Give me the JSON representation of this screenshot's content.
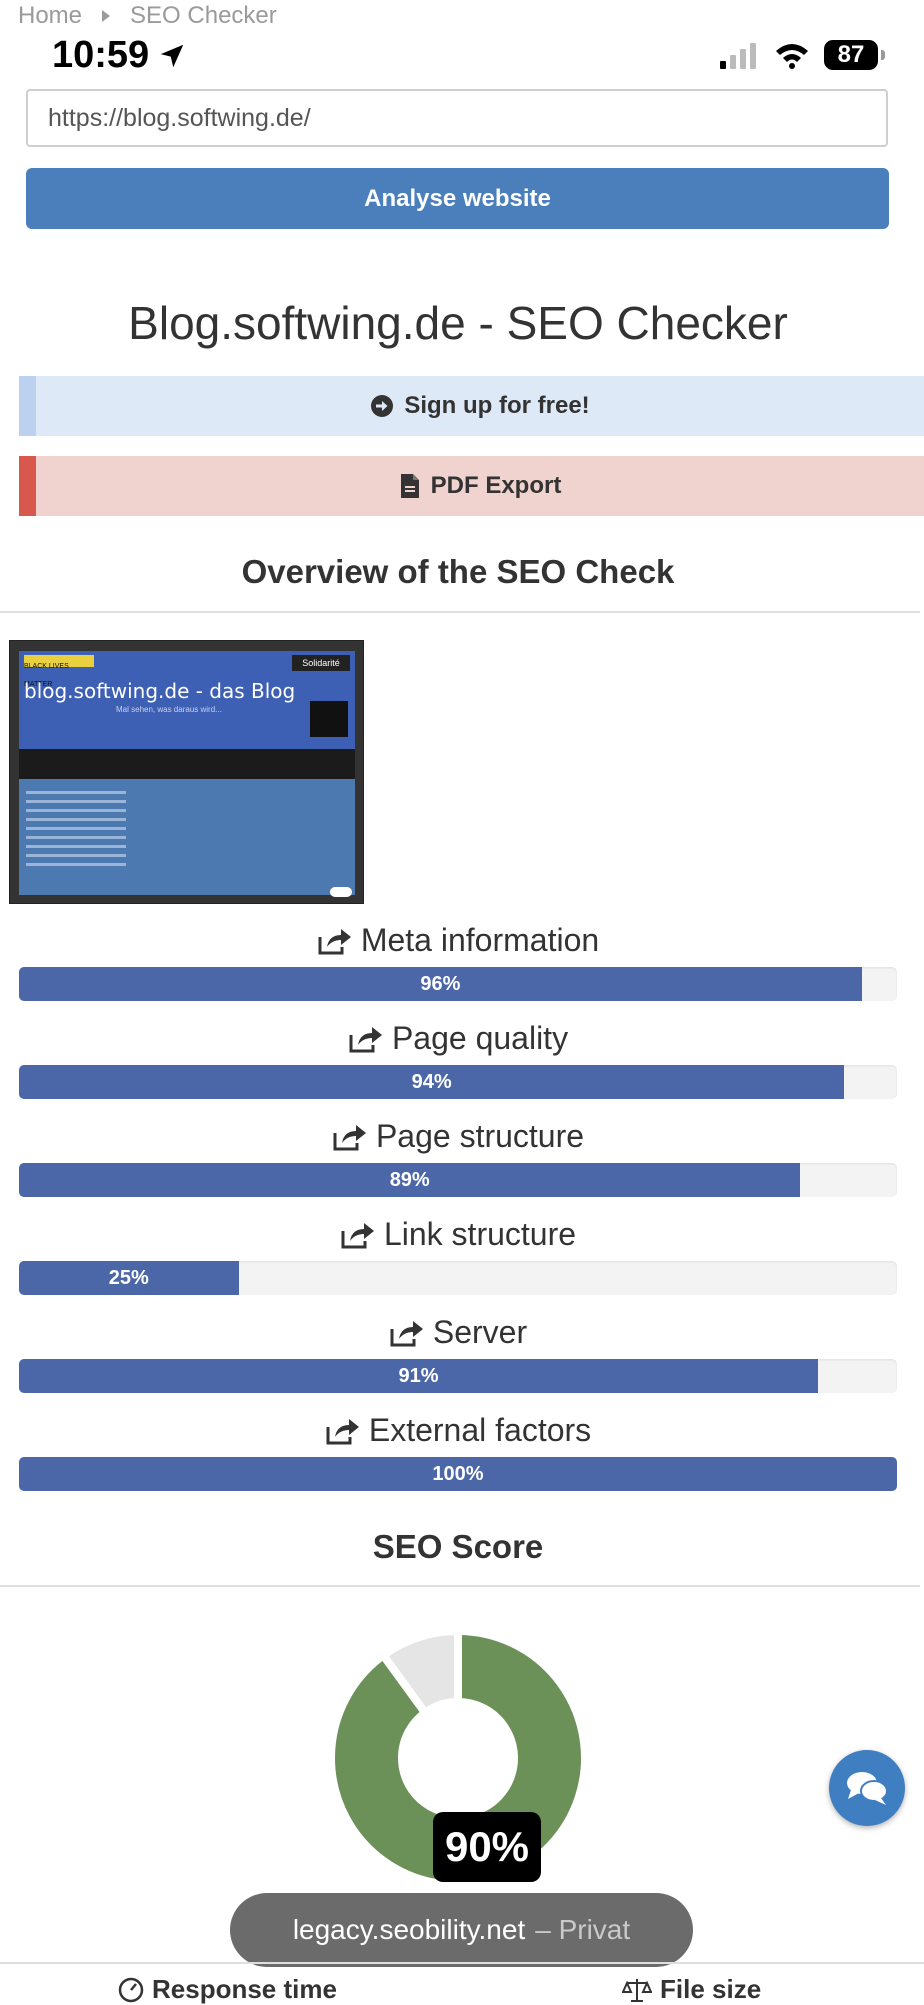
{
  "breadcrumb": {
    "home": "Home",
    "current": "SEO Checker"
  },
  "status_bar": {
    "time": "10:59",
    "battery": "87"
  },
  "url_input": {
    "value": "https://blog.softwing.de/"
  },
  "analyse_button": "Analyse website",
  "page_title": "Blog.softwing.de - SEO Checker",
  "signup_banner": "Sign up for free!",
  "pdf_banner": "PDF Export",
  "overview_title": "Overview of the SEO Check",
  "thumbnail": {
    "badge": "BLACK LIVES MATTER",
    "solidarity": "Solidarité",
    "title": "blog.softwing.de - das Blog",
    "subtitle": "Mal sehen, was daraus wird..."
  },
  "metrics": [
    {
      "label": "Meta information",
      "value": 96,
      "display": "96%"
    },
    {
      "label": "Page quality",
      "value": 94,
      "display": "94%"
    },
    {
      "label": "Page structure",
      "value": 89,
      "display": "89%"
    },
    {
      "label": "Link structure",
      "value": 25,
      "display": "25%"
    },
    {
      "label": "Server",
      "value": 91,
      "display": "91%"
    },
    {
      "label": "External factors",
      "value": 100,
      "display": "100%"
    }
  ],
  "score_title": "SEO Score",
  "score": {
    "value": 90,
    "display": "90%"
  },
  "colors": {
    "bar": "#4c67a8",
    "donut_fill": "#6b9158",
    "donut_rest": "#e5e5e5",
    "button": "#4a7fbc"
  },
  "browser": {
    "domain": "legacy.seobility.net",
    "mode": "– Privat"
  },
  "bottom": {
    "response_time": "Response time",
    "file_size": "File size"
  }
}
